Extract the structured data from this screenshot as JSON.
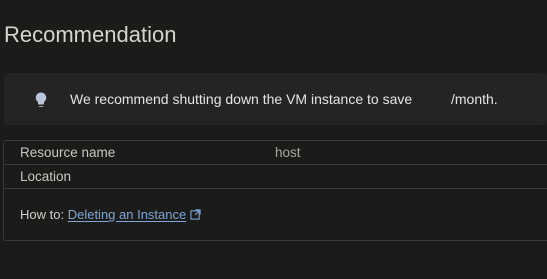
{
  "header": {
    "title": "Recommendation"
  },
  "banner": {
    "icon": "lightbulb-icon",
    "message": "We recommend shutting down the VM instance to save",
    "amount_suffix": "/month."
  },
  "details": {
    "rows": [
      {
        "key": "Resource name",
        "value": "host"
      },
      {
        "key": "Location",
        "value": ""
      }
    ],
    "howto_label": "How to:",
    "howto_link": "Deleting an Instance",
    "howto_link_icon": "open-in-new-icon"
  },
  "colors": {
    "background": "#1b1b1a",
    "banner_background": "#242424",
    "link": "#7fa6d6",
    "border": "#3a3a3a"
  }
}
